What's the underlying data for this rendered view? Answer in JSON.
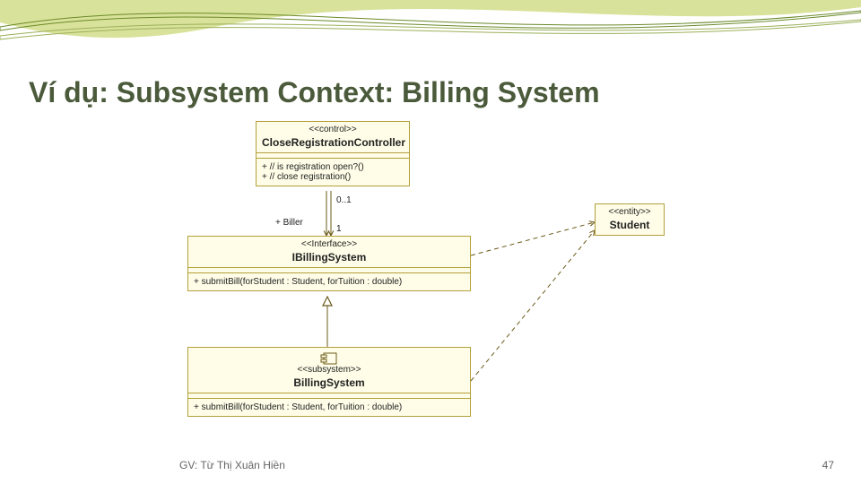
{
  "page": {
    "title": "Ví dụ: Subsystem Context: Billing System",
    "footer_author": "GV: Từ Thị Xuân Hiền",
    "footer_page": "47"
  },
  "uml": {
    "controller": {
      "stereotype": "<<control>>",
      "name": "CloseRegistrationController",
      "op1": "+ // is registration open?()",
      "op2": "+ // close registration()"
    },
    "ibilling": {
      "stereotype": "<<Interface>>",
      "name": "IBillingSystem",
      "op1": "+ submitBill(forStudent : Student, forTuition : double)"
    },
    "billing": {
      "stereotype": "<<subsystem>>",
      "name": "BillingSystem",
      "op1": "+ submitBill(forStudent : Student, forTuition : double)"
    },
    "student": {
      "stereotype": "<<entity>>",
      "name": "Student"
    },
    "assoc": {
      "mult_top": "0..1",
      "mult_bottom": "1",
      "role": "+ Biller"
    }
  }
}
